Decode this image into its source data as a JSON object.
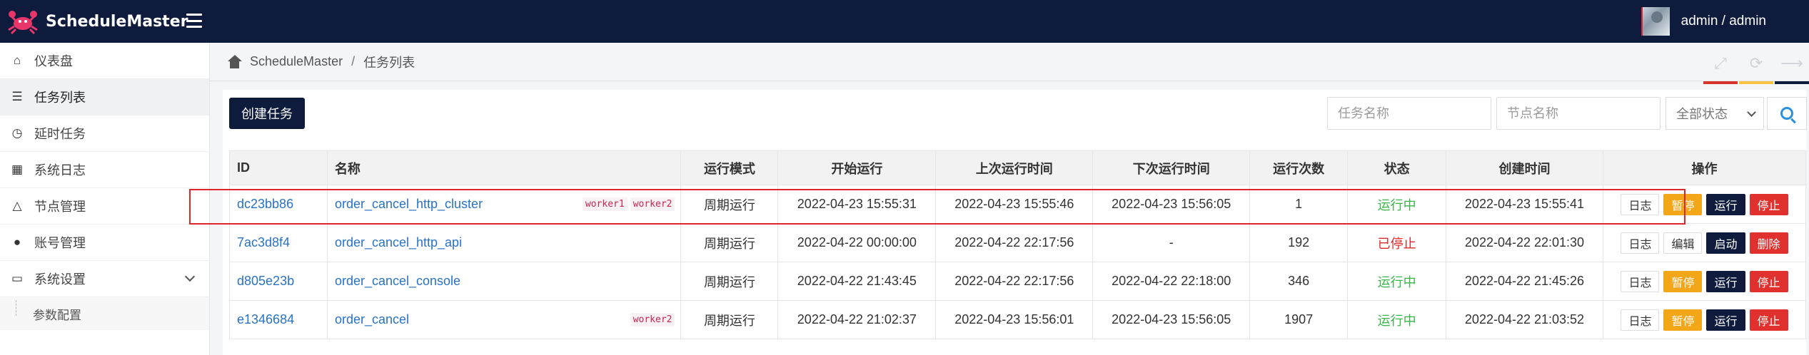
{
  "app": {
    "name": "ScheduleMaster",
    "user": "admin / admin",
    "accent": "#0e1b3c"
  },
  "sidebar": {
    "items": [
      {
        "label": "仪表盘",
        "icon": "home-icon"
      },
      {
        "label": "任务列表",
        "icon": "list-icon"
      },
      {
        "label": "延时任务",
        "icon": "clock-icon"
      },
      {
        "label": "系统日志",
        "icon": "grid-icon"
      },
      {
        "label": "节点管理",
        "icon": "sitemap-icon"
      },
      {
        "label": "账号管理",
        "icon": "user-icon"
      },
      {
        "label": "系统设置",
        "icon": "monitor-icon"
      }
    ],
    "sub_item": "参数配置"
  },
  "breadcrumb": {
    "root": "ScheduleMaster",
    "sep": "/",
    "current": "任务列表"
  },
  "toolbar": {
    "create_label": "创建任务",
    "task_name_placeholder": "任务名称",
    "node_name_placeholder": "节点名称",
    "status_selected": "全部状态"
  },
  "table": {
    "headers": [
      "ID",
      "名称",
      "运行模式",
      "开始运行",
      "上次运行时间",
      "下次运行时间",
      "运行次数",
      "状态",
      "创建时间",
      "操作"
    ],
    "rows": [
      {
        "id": "dc23bb86",
        "name": "order_cancel_http_cluster",
        "tags": [
          "worker1",
          "worker2"
        ],
        "mode": "周期运行",
        "start": "2022-04-23 15:55:31",
        "last": "2022-04-23 15:55:46",
        "next": "2022-04-23 15:56:05",
        "count": "1",
        "status": "运行中",
        "created": "2022-04-23 15:55:41",
        "ops": [
          "日志",
          "暂停",
          "运行",
          "停止"
        ]
      },
      {
        "id": "7ac3d8f4",
        "name": "order_cancel_http_api",
        "tags": [],
        "mode": "周期运行",
        "start": "2022-04-22 00:00:00",
        "last": "2022-04-22 22:17:56",
        "next": "-",
        "count": "192",
        "status": "已停止",
        "created": "2022-04-22 22:01:30",
        "ops": [
          "日志",
          "编辑",
          "启动",
          "删除"
        ]
      },
      {
        "id": "d805e23b",
        "name": "order_cancel_console",
        "tags": [],
        "mode": "周期运行",
        "start": "2022-04-22 21:43:45",
        "last": "2022-04-22 22:17:56",
        "next": "2022-04-22 22:18:00",
        "count": "346",
        "status": "运行中",
        "created": "2022-04-22 21:45:26",
        "ops": [
          "日志",
          "暂停",
          "运行",
          "停止"
        ]
      },
      {
        "id": "e1346684",
        "name": "order_cancel",
        "tags": [
          "worker2"
        ],
        "mode": "周期运行",
        "start": "2022-04-22 21:02:37",
        "last": "2022-04-23 15:56:01",
        "next": "2022-04-23 15:56:05",
        "count": "1907",
        "status": "运行中",
        "created": "2022-04-22 21:03:52",
        "ops": [
          "日志",
          "暂停",
          "运行",
          "停止"
        ]
      }
    ]
  },
  "colors": {
    "running": "#3bb54a",
    "stopped": "#e02828",
    "pause_btn": "#f4a619",
    "stop_btn": "#e0312f",
    "link": "#2a72c3",
    "tool_bars": [
      "#d9342b",
      "#f6c242",
      "#0e1b3c"
    ]
  }
}
